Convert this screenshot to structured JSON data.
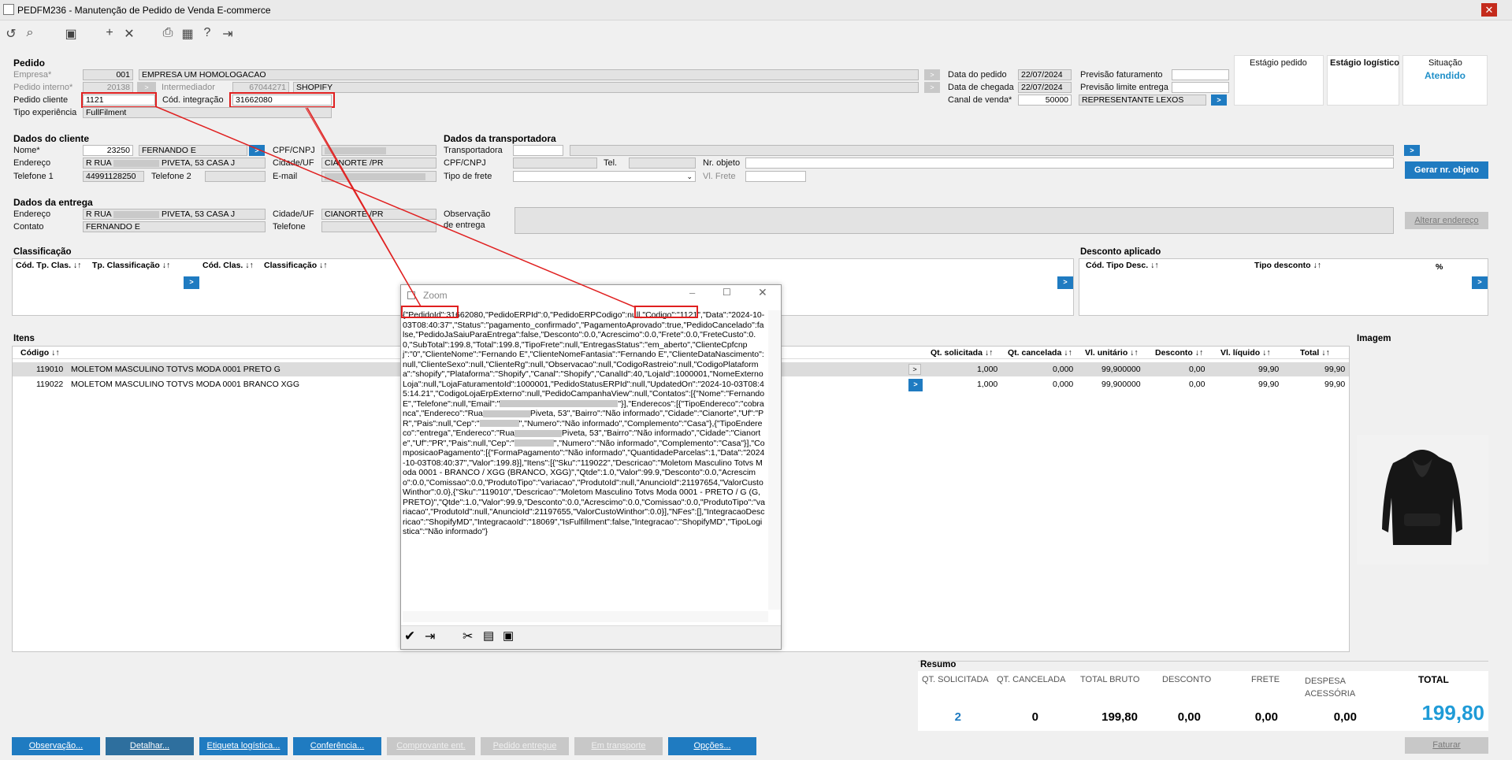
{
  "window": {
    "title": "PEDFM236 - Manutenção de Pedido de Venda E-commerce",
    "close": "✕"
  },
  "pedido": {
    "header": "Pedido",
    "empresa_label": "Empresa*",
    "empresa_code": "001",
    "empresa_name": "EMPRESA UM HOMOLOGACAO",
    "pedido_interno_label": "Pedido interno*",
    "pedido_interno": "20138",
    "intermediador_label": "Intermediador",
    "intermediador_code": "67044271",
    "intermediador_name": "SHOPIFY",
    "pedido_cliente_label": "Pedido cliente",
    "pedido_cliente": "1121",
    "cod_integracao_label": "Cód. integração",
    "cod_integracao": "31662080",
    "tipo_experiencia_label": "Tipo experiência",
    "tipo_experiencia": "FullFilment",
    "data_pedido_label": "Data do pedido",
    "data_pedido": "22/07/2024",
    "data_chegada_label": "Data de chegada",
    "data_chegada": "22/07/2024",
    "canal_venda_label": "Canal de venda*",
    "canal_venda_code": "50000",
    "canal_venda_name": "REPRESENTANTE LEXOS",
    "previsao_fat_label": "Previsão faturamento",
    "previsao_fat": "",
    "previsao_lim_label": "Previsão limite entrega",
    "previsao_lim": "",
    "estagio_pedido_label": "Estágio pedido",
    "estagio_log_label": "Estágio logístico",
    "situacao_label": "Situação",
    "situacao": "Atendido"
  },
  "cliente": {
    "header": "Dados do cliente",
    "nome_label": "Nome*",
    "nome_code": "23250",
    "nome": "FERNANDO E",
    "endereco_label": "Endereço",
    "endereco_a": "R RUA",
    "endereco_b": "PIVETA, 53  CASA J",
    "telefone1_label": "Telefone 1",
    "telefone1": "44991128250",
    "telefone2_label": "Telefone 2",
    "telefone2": "",
    "cpf_label": "CPF/CNPJ",
    "cidade_label": "Cidade/UF",
    "cidade": "CIANORTE /PR",
    "email_label": "E-mail"
  },
  "transportadora": {
    "header": "Dados da transportadora",
    "transp_label": "Transportadora",
    "cpf_label": "CPF/CNPJ",
    "tel_label": "Tel.",
    "nr_objeto_label": "Nr. objeto",
    "tipo_frete_label": "Tipo de frete",
    "vl_frete_label": "Vl. Frete",
    "gerar_btn": "Gerar nr. objeto"
  },
  "entrega": {
    "header": "Dados da entrega",
    "endereco_label": "Endereço",
    "endereco_a": "R RUA",
    "endereco_b": "PIVETA, 53  CASA J",
    "contato_label": "Contato",
    "contato": "FERNANDO E",
    "cidade_label": "Cidade/UF",
    "cidade": "CIANORTE /PR",
    "telefone_label": "Telefone",
    "obs_label1": "Observação",
    "obs_label2": "de entrega",
    "alterar_btn": "Alterar endereço"
  },
  "classificacao": {
    "header": "Classificação",
    "cols": [
      "Cód. Tp. Clas. ↓↑",
      "Tp. Classificação ↓↑",
      "Cód. Clas. ↓↑",
      "Classificação ↓↑"
    ]
  },
  "desconto": {
    "header": "Desconto aplicado",
    "cols": [
      "Cód. Tipo Desc. ↓↑",
      "Tipo desconto ↓↑",
      "%"
    ]
  },
  "itens": {
    "header": "Itens",
    "codigo_col": "Código ↓↑",
    "cols": [
      "Qt. solicitada ↓↑",
      "Qt. cancelada ↓↑",
      "Vl. unitário ↓↑",
      "Desconto ↓↑",
      "Vl. líquido ↓↑",
      "Total ↓↑"
    ],
    "rows": [
      {
        "codigo": "119010",
        "descricao": "MOLETOM MASCULINO TOTVS MODA 0001 PRETO G",
        "qt_sol": "1,000",
        "qt_can": "0,000",
        "vl_unit": "99,900000",
        "desc": "0,00",
        "vl_liq": "99,90",
        "total": "99,90"
      },
      {
        "codigo": "119022",
        "descricao": "MOLETOM MASCULINO TOTVS MODA 0001 BRANCO XGG",
        "qt_sol": "1,000",
        "qt_can": "0,000",
        "vl_unit": "99,900000",
        "desc": "0,00",
        "vl_liq": "99,90",
        "total": "99,90"
      }
    ]
  },
  "imagem": {
    "header": "Imagem",
    "product": "black hoodie"
  },
  "resumo": {
    "header": "Resumo",
    "labels": [
      "QT. SOLICITADA",
      "QT. CANCELADA",
      "TOTAL BRUTO",
      "DESCONTO",
      "FRETE",
      "DESPESA ACESSÓRIA",
      "TOTAL"
    ],
    "values": [
      "2",
      "0",
      "199,80",
      "0,00",
      "0,00",
      "0,00",
      "199,80"
    ]
  },
  "buttons": [
    "Observação...",
    "Detalhar...",
    "Etiqueta logística...",
    "Conferência...",
    "Comprovante ent.",
    "Pedido entregue",
    "Em transporte",
    "Opções...",
    "Faturar"
  ],
  "zoom": {
    "title": "Zoom",
    "p1": "{\"PedidoId\":31662080,",
    "p2": "\"PedidoERPId\":0,\"PedidoERPCodigo\":null,",
    "p3": "\"Codigo\":\"1121\",",
    "p4": "\"Data\":\"2024-10-03T08:40:37\",\"Status\":\"pagamento_confirmado\",\"PagamentoAprovado\":true,\"PedidoCancelado\":false,\"PedidoJaSaiuParaEntrega\":false,\"Desconto\":0.0,\"Acrescimo\":0.0,\"Frete\":0.0,\"FreteCusto\":0.0,\"SubTotal\":199.8,\"Total\":199.8,\"TipoFrete\":null,\"EntregasStatus\":\"em_aberto\",\"ClienteCpfcnpj\":\"0\",\"ClienteNome\":\"Fernando E\",\"ClienteNomeFantasia\":\"Fernando E\",\"ClienteDataNascimento\":null,\"ClienteSexo\":null,\"ClienteRg\":null,\"Observacao\":null,\"CodigoRastreio\":null,\"CodigoPlataforma\":\"shopify\",\"Plataforma\":\"Shopify\",\"Canal\":\"Shopify\",\"CanalId\":40,\"LojaId\":1000001,\"NomeExternoLoja\":null,\"LojaFaturamentoId\":1000001,\"PedidoStatusERPId\":null,\"UpdatedOn\":\"2024-10-03T08:45:14.21\",\"CodigoLojaErpExterno\":null,\"PedidoCampanhaView\":null,\"Contatos\":[{\"Nome\":\"Fernando E\",\"Telefone\":null,\"Email\":\"",
    "p5": "\"}],\"Enderecos\":[{\"TipoEndereco\":\"cobranca\",\"Endereco\":\"Rua",
    "p6": "Piveta, 53\",\"Bairro\":\"Não informado\",\"Cidade\":\"Cianorte\",\"Uf\":\"PR\",\"Pais\":null,\"Cep\":\"",
    "p7": "\",\"Numero\":\"Não informado\",\"Complemento\":\"Casa\"},{\"TipoEndereco\":\"entrega\",\"Endereco\":\"Rua",
    "p8": "Piveta, 53\",\"Bairro\":\"Não informado\",\"Cidade\":\"Cianorte\",\"Uf\":\"PR\",\"Pais\":null,\"Cep\":\"",
    "p9": "\",\"Numero\":\"Não informado\",\"Complemento\":\"Casa\"}],\"ComposicaoPagamento\":[{\"FormaPagamento\":\"Não informado\",\"QuantidadeParcelas\":1,\"Data\":\"2024-10-03T08:40:37\",\"Valor\":199.8}],\"Itens\":[{\"Sku\":\"119022\",\"Descricao\":\"Moletom Masculino Totvs Moda 0001 - BRANCO / XGG (BRANCO, XGG)\",\"Qtde\":1.0,\"Valor\":99.9,\"Desconto\":0.0,\"Acrescimo\":0.0,\"Comissao\":0.0,\"ProdutoTipo\":\"variacao\",\"ProdutoId\":null,\"AnuncioId\":21197654,\"ValorCustoWinthor\":0.0},{\"Sku\":\"119010\",\"Descricao\":\"Moletom Masculino Totvs Moda 0001 - PRETO / G (G, PRETO)\",\"Qtde\":1.0,\"Valor\":99.9,\"Desconto\":0.0,\"Acrescimo\":0.0,\"Comissao\":0.0,\"ProdutoTipo\":\"variacao\",\"ProdutoId\":null,\"AnuncioId\":21197655,\"ValorCustoWinthor\":0.0}],\"NFes\":[],\"IntegracaoDescricao\":\"ShopifyMD\",\"IntegracaoId\":\"18069\",\"IsFulfillment\":false,\"Integracao\":\"ShopifyMD\",\"TipoLogistica\":\"Não informado\"}"
  }
}
